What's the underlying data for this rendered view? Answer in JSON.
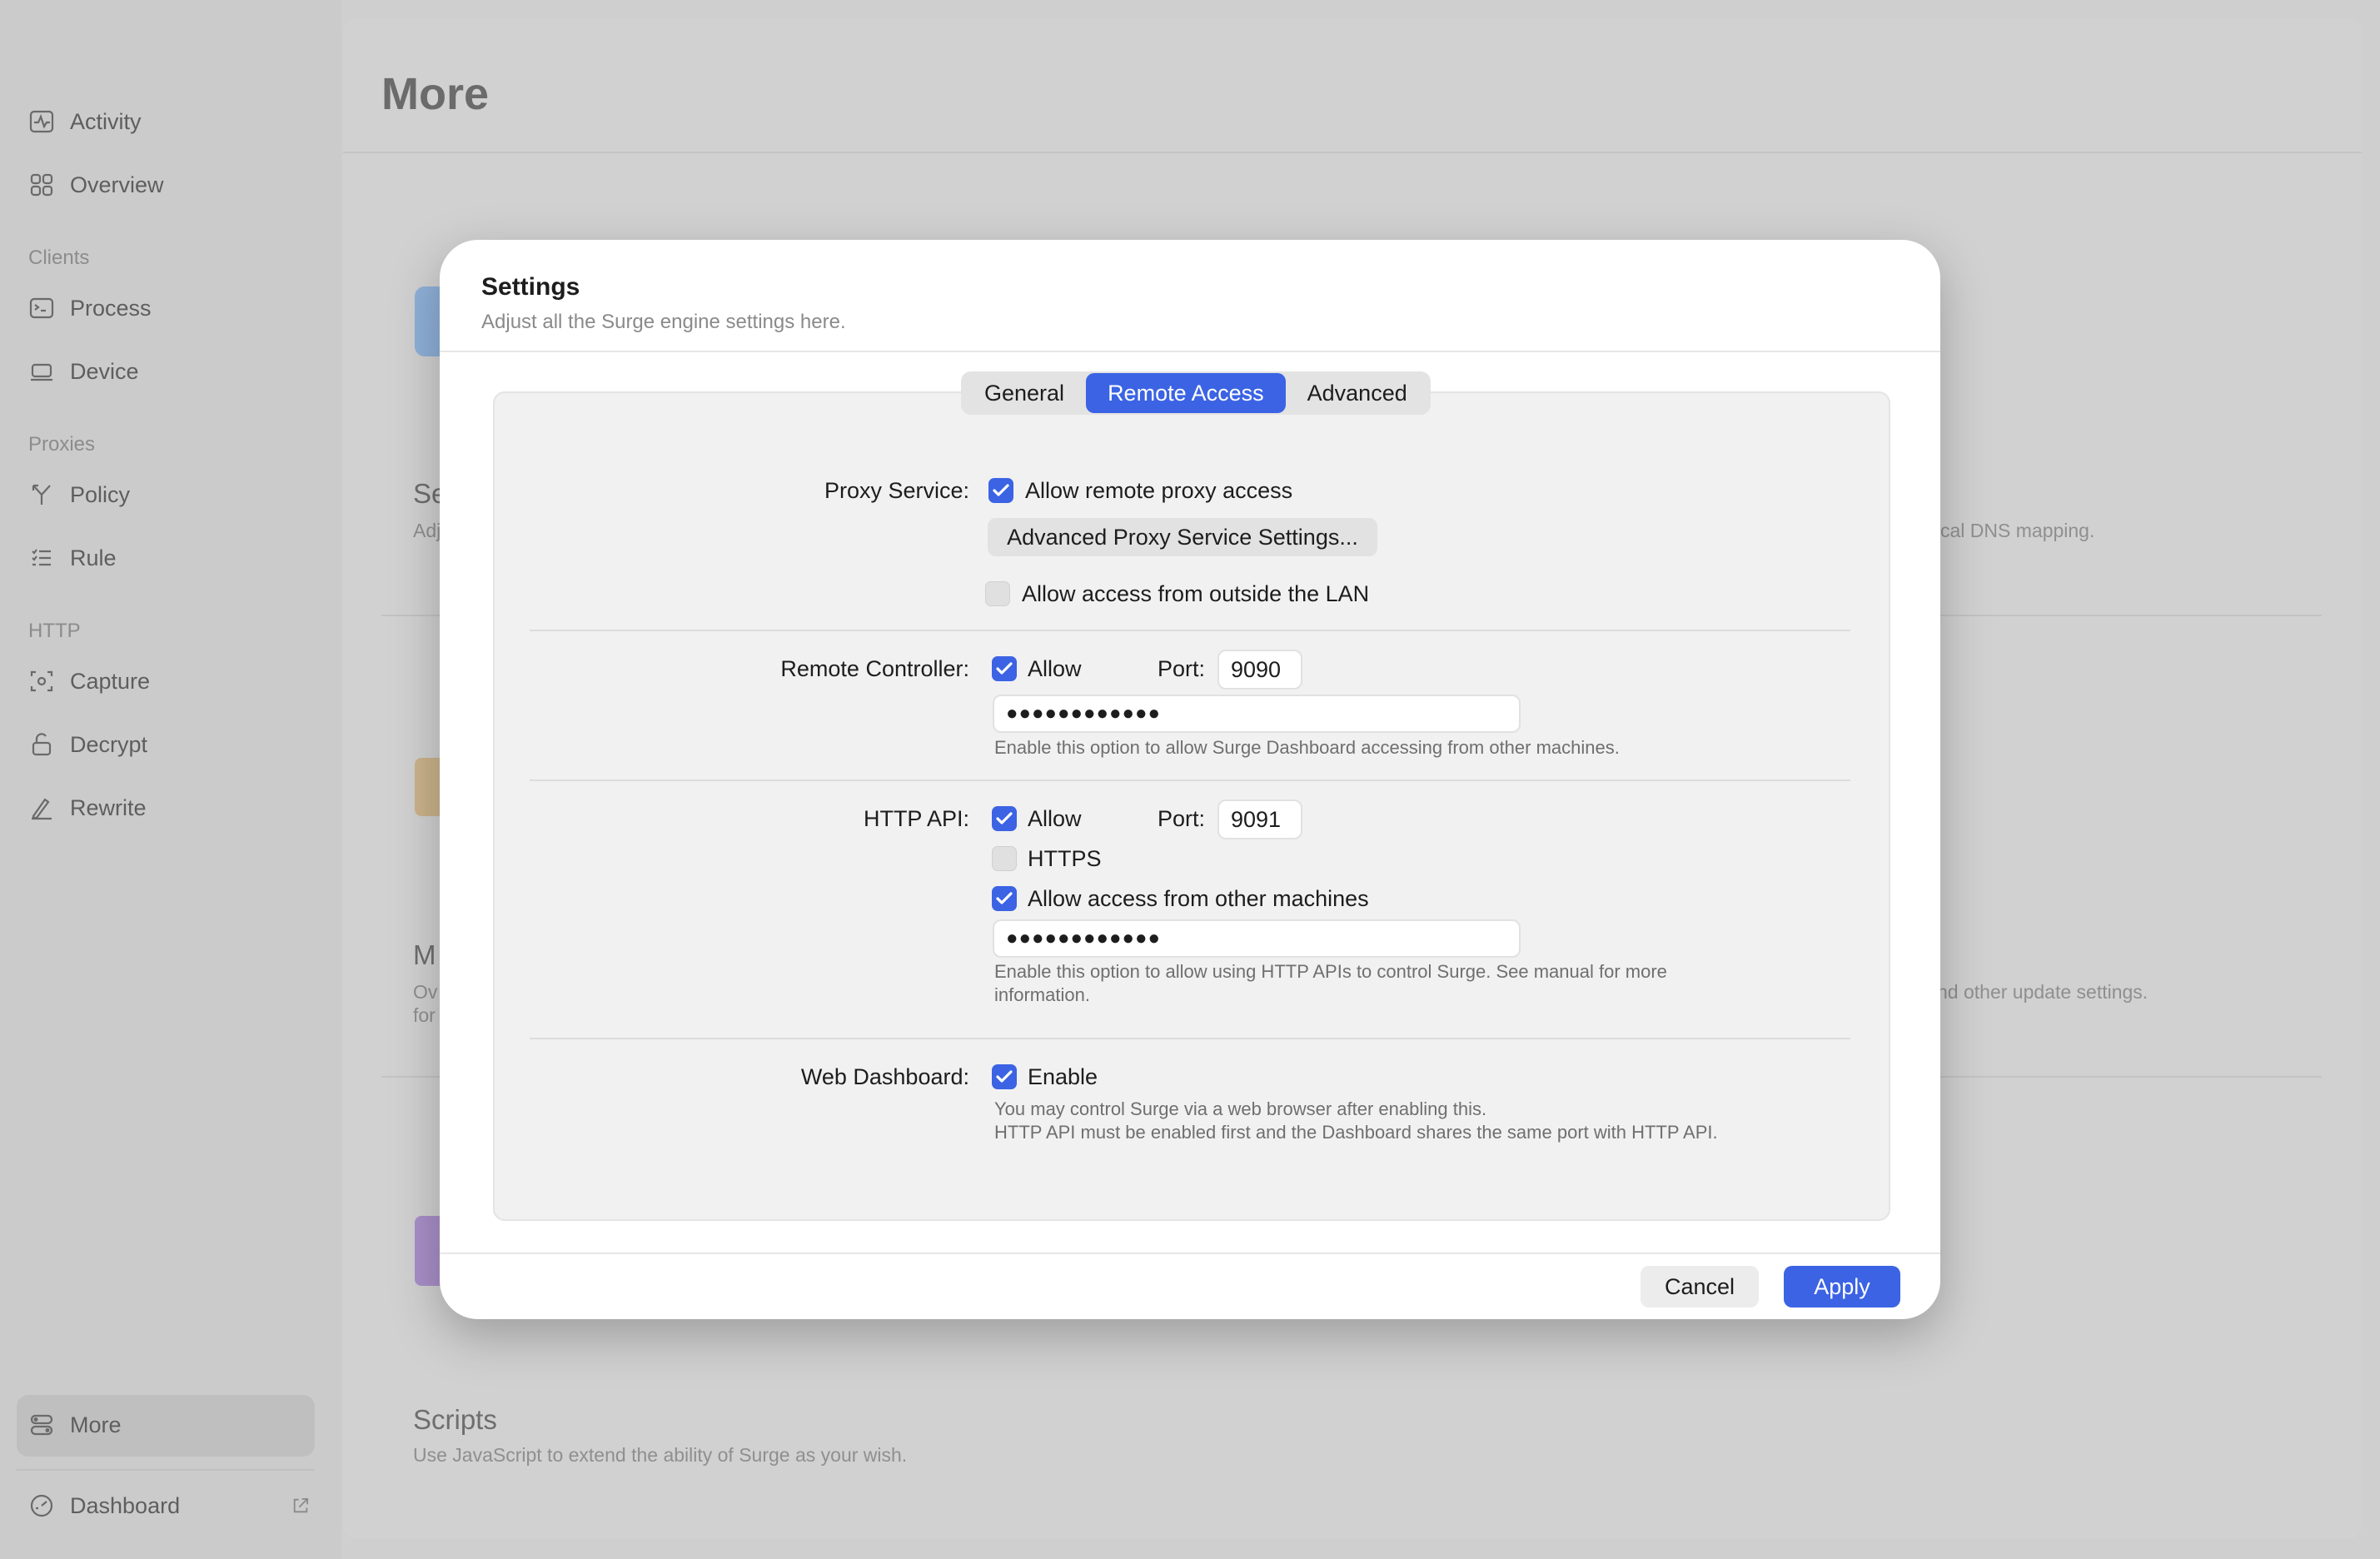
{
  "sidebar": {
    "items": [
      {
        "label": "Activity",
        "icon": "activity-icon"
      },
      {
        "label": "Overview",
        "icon": "overview-icon"
      },
      {
        "label": "Process",
        "icon": "process-icon"
      },
      {
        "label": "Device",
        "icon": "device-icon"
      },
      {
        "label": "Policy",
        "icon": "policy-icon"
      },
      {
        "label": "Rule",
        "icon": "rule-icon"
      },
      {
        "label": "Capture",
        "icon": "capture-icon"
      },
      {
        "label": "Decrypt",
        "icon": "decrypt-icon"
      },
      {
        "label": "Rewrite",
        "icon": "rewrite-icon"
      },
      {
        "label": "More",
        "icon": "more-icon"
      },
      {
        "label": "Dashboard",
        "icon": "dashboard-icon"
      }
    ],
    "sections": {
      "clients": "Clients",
      "proxies": "Proxies",
      "http": "HTTP"
    }
  },
  "main": {
    "title": "More",
    "bg": {
      "se": "Se",
      "adj": "Adj",
      "cal_dns": "cal DNS mapping.",
      "m": "M",
      "ov": "Ov",
      "for": "for",
      "update": "nd other update settings.",
      "scripts_title": "Scripts",
      "scripts_desc": "Use JavaScript to extend the ability of Surge as your wish."
    }
  },
  "modal": {
    "title": "Settings",
    "subtitle": "Adjust all the Surge engine settings here.",
    "tabs": [
      "General",
      "Remote Access",
      "Advanced"
    ],
    "active_tab": "Remote Access",
    "proxy": {
      "label": "Proxy Service:",
      "allow_remote": "Allow remote proxy access",
      "allow_remote_checked": true,
      "advanced_button": "Advanced Proxy Service Settings...",
      "outside_lan": "Allow access from outside the LAN",
      "outside_lan_checked": false
    },
    "remote_controller": {
      "label": "Remote Controller:",
      "allow": "Allow",
      "allow_checked": true,
      "port_label": "Port:",
      "port": "9090",
      "password": "●●●●●●●●●●●●",
      "help": "Enable this option to allow Surge Dashboard accessing from other machines."
    },
    "http_api": {
      "label": "HTTP API:",
      "allow": "Allow",
      "allow_checked": true,
      "port_label": "Port:",
      "port": "9091",
      "https": "HTTPS",
      "https_checked": false,
      "other_machines": "Allow access from other machines",
      "other_machines_checked": true,
      "password": "●●●●●●●●●●●●",
      "help_line1": "Enable this option to allow using HTTP APIs to control Surge. See manual for more",
      "help_line2": "information."
    },
    "web_dashboard": {
      "label": "Web Dashboard:",
      "enable": "Enable",
      "enable_checked": true,
      "help_line1": "You may control Surge via a web browser after enabling this.",
      "help_line2": "HTTP API must be enabled first and the Dashboard shares the same port with HTTP API."
    },
    "cancel": "Cancel",
    "apply": "Apply"
  },
  "colors": {
    "accent": "#3b63e4",
    "traffic_yellow": "#f4be2f",
    "traffic_green": "#2fb14a"
  }
}
